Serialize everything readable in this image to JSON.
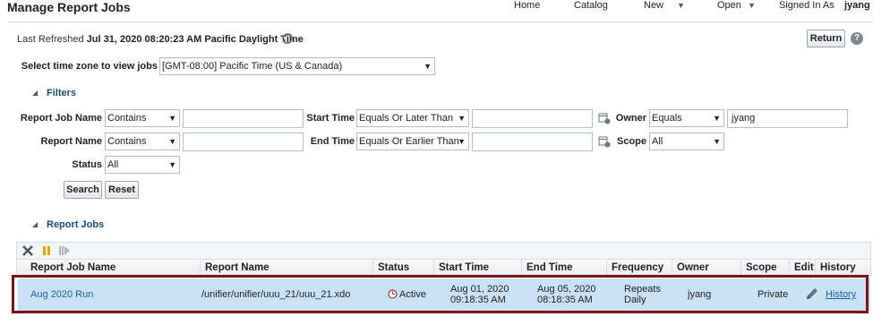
{
  "header": {
    "title": "Manage Report Jobs",
    "nav": [
      {
        "label": "Home",
        "has_menu": false
      },
      {
        "label": "Catalog",
        "has_menu": false
      },
      {
        "label": "New",
        "has_menu": true
      },
      {
        "label": "Open",
        "has_menu": true
      }
    ],
    "signed_in_label": "Signed In As",
    "username": "jyang"
  },
  "refresh": {
    "prefix": "Last Refreshed",
    "timestamp": "Jul 31, 2020 08:20:23 AM Pacific Daylight Time"
  },
  "buttons": {
    "return": "Return",
    "search": "Search",
    "reset": "Reset",
    "help": "?"
  },
  "timezone": {
    "label": "Select time zone to view jobs",
    "value": "[GMT-08:00] Pacific Time (US & Canada)"
  },
  "filters": {
    "section_label": "Filters",
    "report_job_name": {
      "label": "Report Job Name",
      "operator": "Contains",
      "value": ""
    },
    "report_name": {
      "label": "Report Name",
      "operator": "Contains",
      "value": ""
    },
    "status": {
      "label": "Status",
      "value": "All"
    },
    "start_time": {
      "label": "Start Time",
      "operator": "Equals Or Later Than",
      "value": ""
    },
    "end_time": {
      "label": "End Time",
      "operator": "Equals Or Earlier Than",
      "value": ""
    },
    "owner": {
      "label": "Owner",
      "operator": "Equals",
      "value": "jyang"
    },
    "scope": {
      "label": "Scope",
      "value": "All"
    }
  },
  "report_jobs": {
    "section_label": "Report Jobs",
    "toolbar_icons": [
      "delete-icon",
      "pause-icon",
      "resume-icon"
    ],
    "columns": [
      "Report Job Name",
      "Report Name",
      "Status",
      "Start Time",
      "End Time",
      "Frequency",
      "Owner",
      "Scope",
      "Edit",
      "History"
    ],
    "rows": [
      {
        "job_name": "Aug 2020 Run",
        "report_name": "/unifier/unifier/uuu_21/uuu_21.xdo",
        "status": "Active",
        "start_date": "Aug 01, 2020",
        "start_time": "09:18:35 AM",
        "end_date": "Aug 05, 2020",
        "end_time": "08:18:35 AM",
        "frequency_1": "Repeats",
        "frequency_2": "Daily",
        "owner": "jyang",
        "scope": "Private",
        "history": "History"
      }
    ]
  },
  "colors": {
    "selected_row": "#c9e2f5",
    "highlight_border": "#7a1414",
    "link": "#1f5fa6",
    "section": "#1a4a78"
  }
}
